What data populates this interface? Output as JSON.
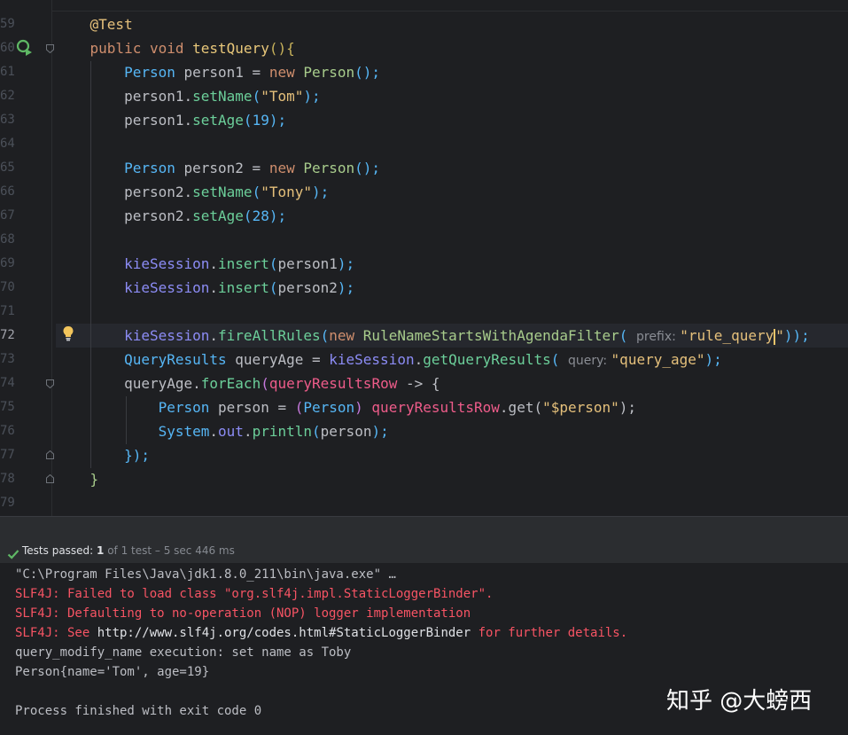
{
  "colors": {
    "keyword": "#cf8e6d",
    "annotation": "#b3ae60",
    "method": "#56a8f5",
    "class": "#56a8f5",
    "string": "#6aab73",
    "number": "#2aacb8",
    "field": "#c77dbb",
    "plain": "#bcbec4"
  },
  "editor": {
    "lines": [
      {
        "num": "59",
        "tokens": [
          {
            "t": "    @Test",
            "c": "#e5c07b"
          }
        ]
      },
      {
        "num": "60",
        "tokens": [
          {
            "t": "    public void ",
            "c": "#cf8e6d"
          },
          {
            "t": "testQuery",
            "c": "#e8c77a"
          },
          {
            "t": "(){",
            "c": "#c9b35b"
          }
        ]
      },
      {
        "num": "61",
        "tokens": [
          {
            "t": "        ",
            "c": "#bcbec4"
          },
          {
            "t": "Person",
            "c": "#56b6f5"
          },
          {
            "t": " person1 = ",
            "c": "#bcbec4"
          },
          {
            "t": "new ",
            "c": "#cf8e6d"
          },
          {
            "t": "Person",
            "c": "#a8cc8c"
          },
          {
            "t": "();",
            "c": "#56b6f5"
          }
        ]
      },
      {
        "num": "62",
        "tokens": [
          {
            "t": "        person1.",
            "c": "#bcbec4"
          },
          {
            "t": "setName",
            "c": "#6ccf9a"
          },
          {
            "t": "(",
            "c": "#56b6f5"
          },
          {
            "t": "\"Tom\"",
            "c": "#e5c07b"
          },
          {
            "t": ");",
            "c": "#56b6f5"
          }
        ]
      },
      {
        "num": "63",
        "tokens": [
          {
            "t": "        person1.",
            "c": "#bcbec4"
          },
          {
            "t": "setAge",
            "c": "#6ccf9a"
          },
          {
            "t": "(",
            "c": "#56b6f5"
          },
          {
            "t": "19",
            "c": "#56b6f5"
          },
          {
            "t": ");",
            "c": "#56b6f5"
          }
        ]
      },
      {
        "num": "64",
        "tokens": []
      },
      {
        "num": "65",
        "tokens": [
          {
            "t": "        ",
            "c": "#bcbec4"
          },
          {
            "t": "Person",
            "c": "#56b6f5"
          },
          {
            "t": " person2 = ",
            "c": "#bcbec4"
          },
          {
            "t": "new ",
            "c": "#cf8e6d"
          },
          {
            "t": "Person",
            "c": "#a8cc8c"
          },
          {
            "t": "();",
            "c": "#56b6f5"
          }
        ]
      },
      {
        "num": "66",
        "tokens": [
          {
            "t": "        person2.",
            "c": "#bcbec4"
          },
          {
            "t": "setName",
            "c": "#6ccf9a"
          },
          {
            "t": "(",
            "c": "#56b6f5"
          },
          {
            "t": "\"Tony\"",
            "c": "#e5c07b"
          },
          {
            "t": ");",
            "c": "#56b6f5"
          }
        ]
      },
      {
        "num": "67",
        "tokens": [
          {
            "t": "        person2.",
            "c": "#bcbec4"
          },
          {
            "t": "setAge",
            "c": "#6ccf9a"
          },
          {
            "t": "(",
            "c": "#56b6f5"
          },
          {
            "t": "28",
            "c": "#56b6f5"
          },
          {
            "t": ");",
            "c": "#56b6f5"
          }
        ]
      },
      {
        "num": "68",
        "tokens": []
      },
      {
        "num": "69",
        "tokens": [
          {
            "t": "        ",
            "c": "#bcbec4"
          },
          {
            "t": "kieSession",
            "c": "#8c8cf5"
          },
          {
            "t": ".",
            "c": "#bcbec4"
          },
          {
            "t": "insert",
            "c": "#6ccf9a"
          },
          {
            "t": "(",
            "c": "#56b6f5"
          },
          {
            "t": "person1",
            "c": "#bcbec4"
          },
          {
            "t": ");",
            "c": "#56b6f5"
          }
        ]
      },
      {
        "num": "70",
        "tokens": [
          {
            "t": "        ",
            "c": "#bcbec4"
          },
          {
            "t": "kieSession",
            "c": "#8c8cf5"
          },
          {
            "t": ".",
            "c": "#bcbec4"
          },
          {
            "t": "insert",
            "c": "#6ccf9a"
          },
          {
            "t": "(",
            "c": "#56b6f5"
          },
          {
            "t": "person2",
            "c": "#bcbec4"
          },
          {
            "t": ");",
            "c": "#56b6f5"
          }
        ]
      },
      {
        "num": "71",
        "tokens": []
      },
      {
        "num": "72",
        "current": true,
        "tokens": [
          {
            "t": "        ",
            "c": "#bcbec4"
          },
          {
            "t": "kieSession",
            "c": "#8c8cf5"
          },
          {
            "t": ".",
            "c": "#bcbec4"
          },
          {
            "t": "fireAllRules",
            "c": "#6ccf9a"
          },
          {
            "t": "(",
            "c": "#56b6f5"
          },
          {
            "t": "new ",
            "c": "#cf8e6d"
          },
          {
            "t": "RuleNameStartsWithAgendaFilter",
            "c": "#a8cc8c"
          },
          {
            "t": "( ",
            "c": "#56b6f5"
          },
          {
            "t": "prefix: ",
            "c": "#8a8d94",
            "hint": true
          },
          {
            "t": "\"rule_query",
            "c": "#e5c07b"
          },
          {
            "caret": true
          },
          {
            "t": "\"",
            "c": "#e5c07b"
          },
          {
            "t": "));",
            "c": "#56b6f5"
          }
        ]
      },
      {
        "num": "73",
        "tokens": [
          {
            "t": "        ",
            "c": "#bcbec4"
          },
          {
            "t": "QueryResults",
            "c": "#56b6f5"
          },
          {
            "t": " queryAge = ",
            "c": "#bcbec4"
          },
          {
            "t": "kieSession",
            "c": "#8c8cf5"
          },
          {
            "t": ".",
            "c": "#bcbec4"
          },
          {
            "t": "getQueryResults",
            "c": "#6ccf9a"
          },
          {
            "t": "( ",
            "c": "#56b6f5"
          },
          {
            "t": "query: ",
            "c": "#8a8d94",
            "hint": true
          },
          {
            "t": "\"query_age\"",
            "c": "#e5c07b"
          },
          {
            "t": ");",
            "c": "#56b6f5"
          }
        ]
      },
      {
        "num": "74",
        "tokens": [
          {
            "t": "        queryAge.",
            "c": "#bcbec4"
          },
          {
            "t": "forEach",
            "c": "#6ccf9a"
          },
          {
            "t": "(",
            "c": "#c678dd"
          },
          {
            "t": "queryResultsRow",
            "c": "#ee5c8a"
          },
          {
            "t": " -> {",
            "c": "#bcbec4"
          }
        ]
      },
      {
        "num": "75",
        "tokens": [
          {
            "t": "            ",
            "c": "#bcbec4"
          },
          {
            "t": "Person",
            "c": "#56b6f5"
          },
          {
            "t": " person = ",
            "c": "#bcbec4"
          },
          {
            "t": "(",
            "c": "#c678dd"
          },
          {
            "t": "Person",
            "c": "#56b6f5"
          },
          {
            "t": ") ",
            "c": "#c678dd"
          },
          {
            "t": "queryResultsRow",
            "c": "#ee5c8a"
          },
          {
            "t": ".get(",
            "c": "#bcbec4"
          },
          {
            "t": "\"$person\"",
            "c": "#e5c07b"
          },
          {
            "t": ");",
            "c": "#bcbec4"
          }
        ]
      },
      {
        "num": "76",
        "tokens": [
          {
            "t": "            ",
            "c": "#bcbec4"
          },
          {
            "t": "System",
            "c": "#56b6f5"
          },
          {
            "t": ".",
            "c": "#bcbec4"
          },
          {
            "t": "out",
            "c": "#8c8cf5"
          },
          {
            "t": ".",
            "c": "#bcbec4"
          },
          {
            "t": "println",
            "c": "#6ccf9a"
          },
          {
            "t": "(",
            "c": "#56b6f5"
          },
          {
            "t": "person",
            "c": "#bcbec4"
          },
          {
            "t": ");",
            "c": "#56b6f5"
          }
        ]
      },
      {
        "num": "77",
        "tokens": [
          {
            "t": "        });",
            "c": "#56b6f5"
          }
        ]
      },
      {
        "num": "78",
        "tokens": [
          {
            "t": "    }",
            "c": "#a8cc8c"
          }
        ]
      },
      {
        "num": "79",
        "tokens": []
      }
    ]
  },
  "status": {
    "label": "Tests passed: ",
    "passed": "1",
    "rest": " of 1 test – 5 sec 446 ms"
  },
  "console": {
    "lines": [
      [
        {
          "t": "\"C:\\Program Files\\Java\\jdk1.8.0_211\\bin\\java.exe\"",
          "k": "plain"
        },
        {
          "t": " …",
          "k": "dots"
        }
      ],
      [
        {
          "t": "SLF4J: Failed to load class \"org.slf4j.impl.StaticLoggerBinder\".",
          "k": "err"
        }
      ],
      [
        {
          "t": "SLF4J: Defaulting to no-operation (NOP) logger implementation",
          "k": "err"
        }
      ],
      [
        {
          "t": "SLF4J: See ",
          "k": "err"
        },
        {
          "t": "http://www.slf4j.org/codes.html#StaticLoggerBinder",
          "k": "link"
        },
        {
          "t": " for further details.",
          "k": "err"
        }
      ],
      [
        {
          "t": "query_modify_name execution: set name as Toby",
          "k": "plain"
        }
      ],
      [
        {
          "t": "Person{name='Tom', age=19}",
          "k": "plain"
        }
      ],
      [],
      [
        {
          "t": "Process finished with exit code 0",
          "k": "plain"
        }
      ]
    ]
  },
  "watermark": "知乎 @大螃西"
}
